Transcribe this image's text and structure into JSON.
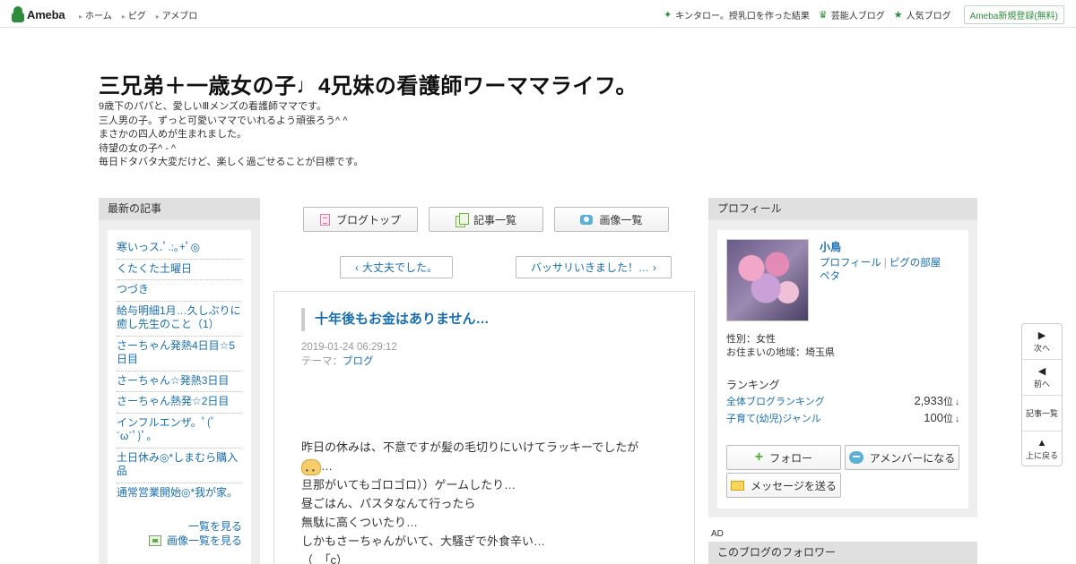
{
  "topbar": {
    "logo": "Ameba",
    "nav": [
      "ホーム",
      "ピグ",
      "アメブロ"
    ],
    "links": [
      {
        "icon": "sparkle-icon",
        "label": "キンタロー。授乳口を作った結果"
      },
      {
        "icon": "crown-icon",
        "label": "芸能人ブログ"
      },
      {
        "icon": "star-icon",
        "label": "人気ブログ"
      }
    ],
    "signup": "Ameba新規登録(無料)"
  },
  "header": {
    "title": "三兄弟＋一歳女の子♩4兄妹の看護師ワーママライフ。",
    "desc": [
      "9歳下のパパと、愛しいⅢメンズの看護師ママです。",
      "三人男の子。ずっと可愛いママでいれるよう頑張ろう^ ^",
      "まさかの四人めが生まれました。",
      "待望の女の子^ - ^",
      "毎日ドタバタ大変だけど、楽しく過ごせることが目標です。"
    ]
  },
  "recent": {
    "heading": "最新の記事",
    "items": [
      "寒いっス.ﾟ.:｡+ﾟ◎",
      "くたくた土曜日",
      "つづき",
      "給与明細1月…久しぶりに癒し先生のこと（1）",
      "さーちゃん発熱4日目☆5日目",
      "さーちゃん☆発熱3日目",
      "さーちゃん熱発☆2日目",
      "インフルエンザ。ﾟ(ﾟ´ω`ﾟ)ﾟ。",
      "土日休み◎*しまむら購入品",
      "通常営業開始◎*我が家。"
    ],
    "see_all": "一覧を見る",
    "see_images": "画像一覧を見る"
  },
  "buttons": {
    "blog_top": "ブログトップ",
    "articles": "記事一覧",
    "images": "画像一覧"
  },
  "pager": {
    "prev": "大丈夫でした。",
    "next": "バッサリいきました！…"
  },
  "article": {
    "title": "十年後もお金はありません…",
    "date": "2019-01-24 06:29:12",
    "theme_label": "テーマ：",
    "theme": "ブログ",
    "body1": "昨日の休みは、不意ですが髪の毛切りにいけてラッキーでしたが",
    "body1b": "…",
    "body2": "旦那がいてもゴロゴロ））ゲームしたり…",
    "body3": "昼ごはん、パスタなんて行ったら",
    "body4": "無駄に高くついたり…",
    "body5": "しかもさーちゃんがいて、大騒ぎで外食辛い…",
    "body6": "（　「c）"
  },
  "profile": {
    "heading": "プロフィール",
    "name": "小鳥",
    "link_profile": "プロフィール",
    "link_pig": "ピグの部屋",
    "link_peta": "ペタ",
    "gender": "性別：女性",
    "area": "お住まいの地域：埼玉県",
    "ranking_heading": "ランキング",
    "rankings": [
      {
        "label": "全体ブログランキング",
        "value": "2,933",
        "unit": "位",
        "arrow": "↓"
      },
      {
        "label": "子育て(幼児)ジャンル",
        "value": "100",
        "unit": "位",
        "arrow": "↓"
      }
    ],
    "follow": "フォロー",
    "amember": "アメンバーになる",
    "message": "メッセージを送る"
  },
  "ad_label": "AD",
  "followers_heading": "このブログのフォロワー",
  "sidenav": {
    "next_glyph": "▶",
    "next": "次へ",
    "prev_glyph": "◀",
    "prev": "前へ",
    "list": "記事一覧",
    "top_glyph": "▲",
    "top": "上に戻る"
  }
}
